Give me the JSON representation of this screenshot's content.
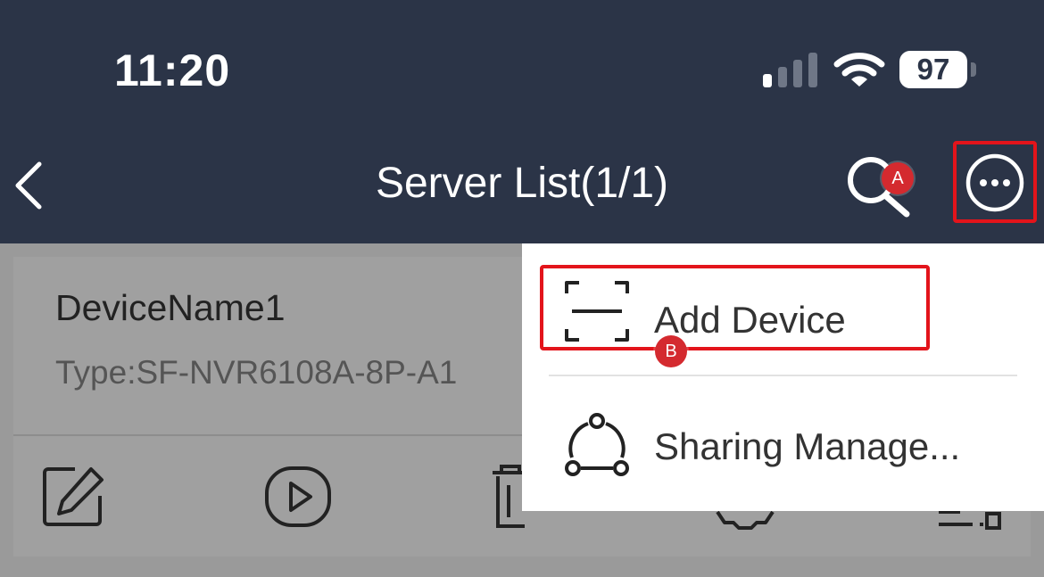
{
  "status_bar": {
    "time": "11:20",
    "battery": "97",
    "icons": [
      "signal-icon",
      "wifi-icon",
      "battery-icon"
    ]
  },
  "nav": {
    "title": "Server List(1/1)",
    "icons": [
      "back-icon",
      "search-icon",
      "more-icon"
    ]
  },
  "annotations": {
    "a": "A",
    "b": "B",
    "color": "#e3141b"
  },
  "device": {
    "name": "DeviceName1",
    "type": "Type:SF-NVR6108A-8P-A1",
    "actions": [
      "edit-icon",
      "play-icon",
      "delete-icon",
      "settings-icon",
      "more-settings-icon"
    ]
  },
  "menu": {
    "add_device": "Add Device",
    "sharing_manage": "Sharing Manage...",
    "icons": [
      "scan-icon",
      "share-icon"
    ]
  },
  "colors": {
    "header": "#2b3447",
    "overlay": "#9a9a9a",
    "menu": "#ffffff"
  }
}
